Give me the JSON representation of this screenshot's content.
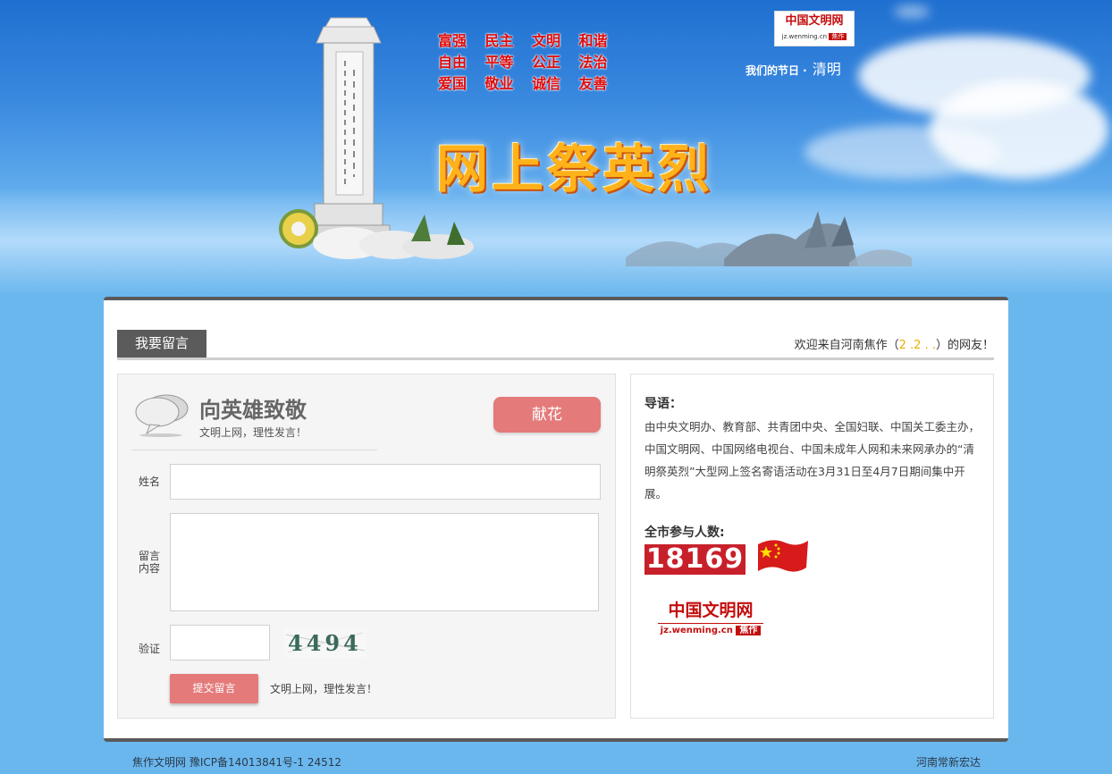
{
  "banner": {
    "values": [
      "富强",
      "民主",
      "文明",
      "和谐",
      "自由",
      "平等",
      "公正",
      "法治",
      "爱国",
      "敬业",
      "诚信",
      "友善"
    ],
    "title": "网上祭英烈",
    "logo": {
      "name": "中国文明网",
      "domain": "jz.wenming.cn",
      "city": "焦作"
    },
    "festival_label": "我们的节日 ·",
    "festival_name": "清明"
  },
  "panel": {
    "tab_label": "我要留言",
    "welcome_prefix": "欢迎来自河南焦作（",
    "welcome_ip": "2 .2 .  .",
    "welcome_suffix": "）的网友！"
  },
  "form": {
    "title": "向英雄致敬",
    "subtitle": "文明上网，理性发言！",
    "flower_button": "献花",
    "name_label": "姓名",
    "message_label_1": "留言",
    "message_label_2": "内容",
    "captcha_label": "验证",
    "captcha_text": "4494",
    "submit_button": "提交留言",
    "submit_note": "文明上网，理性发言！"
  },
  "info": {
    "guide_heading": "导语：",
    "guide_text": "由中央文明办、教育部、共青团中央、全国妇联、中国关工委主办，中国文明网、中国网络电视台、中国未成年人网和未来网承办的“清明祭英烈”大型网上签名寄语活动在3月31日至4月7日期间集中开展。",
    "count_heading": "全市参与人数:",
    "count_value": "18169",
    "logo": {
      "name": "中国文明网",
      "domain": "jz.wenming.cn",
      "city": "焦作"
    }
  },
  "footer": {
    "left": "焦作文明网 豫ICP备14013841号-1 24512",
    "right": "河南常新宏达"
  },
  "colors": {
    "accent_red": "#c8202a",
    "button_pink": "#e47a7a",
    "tab_gray": "#5b5b5b",
    "sky_blue": "#6ab7ee"
  }
}
